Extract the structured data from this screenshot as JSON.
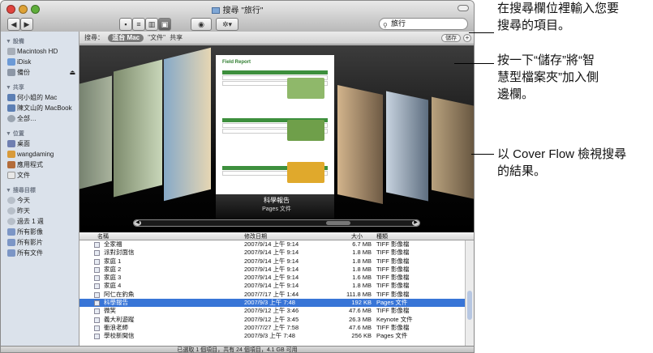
{
  "window": {
    "title": "搜尋 \"旅行\"",
    "status": "已選取 1 個項目，共有 24 個項目，4.1 GB 可用"
  },
  "toolbar": {
    "back": "◀",
    "forward": "▶",
    "view_icon": "◉",
    "action": "✲▾"
  },
  "search": {
    "value": "旅行"
  },
  "scope": {
    "label": "搜尋：",
    "selected": "這台 Mac",
    "option2": "\"文件\"",
    "option3": "共享",
    "save": "儲存",
    "add": "+"
  },
  "sidebar": {
    "devices_header": "▼ 設備",
    "devices": [
      {
        "label": "Macintosh HD",
        "color": "#a7aeb8"
      },
      {
        "label": "iDisk",
        "color": "#6c9ad6"
      },
      {
        "label": "備份",
        "color": "#8d97a6",
        "eject": "⏏"
      }
    ],
    "shared_header": "▼ 共享",
    "shared": [
      {
        "label": "何小姐的 Mac",
        "color": "#5c7fb4"
      },
      {
        "label": "陳文山的 MacBook",
        "color": "#5c7fb4"
      },
      {
        "label": "全部…",
        "color": "#9aa4b0"
      }
    ],
    "places_header": "▼ 位置",
    "places": [
      {
        "label": "桌面",
        "color": "#6f7fb1"
      },
      {
        "label": "wangdaming",
        "color": "#d89a3a"
      },
      {
        "label": "應用程式",
        "color": "#b36c3a"
      },
      {
        "label": "文件",
        "color": "#e8e8e8"
      }
    ],
    "search_header": "▼ 搜尋目標",
    "searches": [
      {
        "label": "今天",
        "color": "#b7bfc9"
      },
      {
        "label": "昨天",
        "color": "#b7bfc9"
      },
      {
        "label": "過去 1 週",
        "color": "#b7bfc9"
      },
      {
        "label": "所有影像",
        "color": "#7c96c6"
      },
      {
        "label": "所有影片",
        "color": "#7c96c6"
      },
      {
        "label": "所有文件",
        "color": "#7c96c6"
      }
    ]
  },
  "coverflow": {
    "name": "科學報告",
    "kind": "Pages 文件",
    "doc_title": "Field Report",
    "left_arrow": "◀",
    "right_arrow": "▶",
    "position_fraction": 0.75
  },
  "list": {
    "headers": {
      "name": "名稱",
      "date": "修改日期",
      "size": "大小",
      "kind": "種類"
    },
    "rows": [
      {
        "name": "全家福",
        "date": "2007/9/14 上午 9:14",
        "size": "6.7 MB",
        "kind": "TIFF 影像檔"
      },
      {
        "name": "派對封面信",
        "date": "2007/9/14 上午 9:14",
        "size": "1.8 MB",
        "kind": "TIFF 影像檔"
      },
      {
        "name": "家庭 1",
        "date": "2007/9/14 上午 9:14",
        "size": "1.8 MB",
        "kind": "TIFF 影像檔"
      },
      {
        "name": "家庭 2",
        "date": "2007/9/14 上午 9:14",
        "size": "1.8 MB",
        "kind": "TIFF 影像檔"
      },
      {
        "name": "家庭 3",
        "date": "2007/9/14 上午 9:14",
        "size": "1.6 MB",
        "kind": "TIFF 影像檔"
      },
      {
        "name": "家庭 4",
        "date": "2007/9/14 上午 9:14",
        "size": "1.8 MB",
        "kind": "TIFF 影像檔"
      },
      {
        "name": "阿仁在釣魚",
        "date": "2007/7/17 上午 1:44",
        "size": "111.8 MB",
        "kind": "TIFF 影像檔"
      },
      {
        "name": "科學報告",
        "date": "2007/9/3 上午 7:48",
        "size": "192 KB",
        "kind": "Pages 文件",
        "selected": true
      },
      {
        "name": "微笑",
        "date": "2007/9/12 上午 3:46",
        "size": "47.6 MB",
        "kind": "TIFF 影像檔"
      },
      {
        "name": "義大利遊蹤",
        "date": "2007/9/12 上午 3:45",
        "size": "26.3 MB",
        "kind": "Keynote 文件"
      },
      {
        "name": "衝浪老師",
        "date": "2007/7/27 上午 7:58",
        "size": "47.6 MB",
        "kind": "TIFF 影像檔"
      },
      {
        "name": "學校新聞信",
        "date": "2007/9/3 上午 7:48",
        "size": "256 KB",
        "kind": "Pages 文件"
      }
    ]
  },
  "callouts": {
    "search_line1": "在搜尋欄位裡輸入您要",
    "search_line2": "搜尋的項目。",
    "save_line1": "按一下“儲存”將“智",
    "save_line2": "慧型檔案夾”加入側",
    "save_line3": "邊欄。",
    "cover_line1": "以 Cover Flow 檢視搜尋",
    "cover_line2": "的結果。"
  }
}
